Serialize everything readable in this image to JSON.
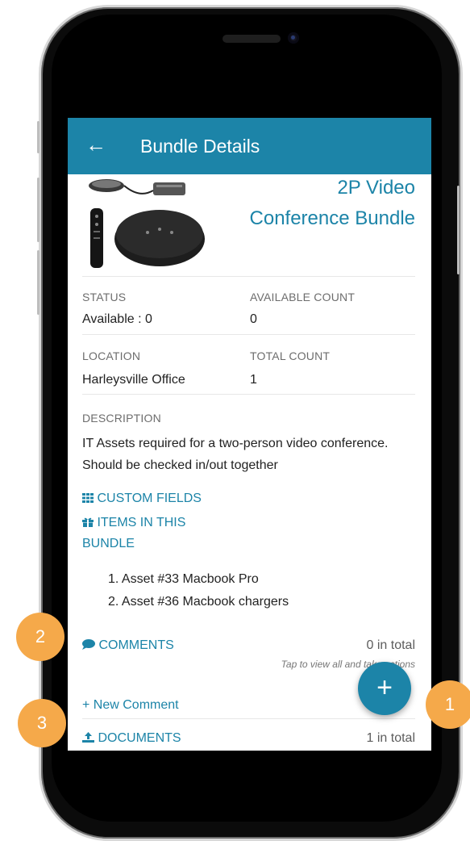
{
  "app": {
    "title": "Bundle Details",
    "back_icon": "arrow-left-icon"
  },
  "bundle": {
    "name_line1": "2P Video",
    "name_line2": "Conference Bundle",
    "status_label": "STATUS",
    "status_value": "Available : 0",
    "available_label": "AVAILABLE COUNT",
    "available_value": "0",
    "location_label": "LOCATION",
    "location_value": "Harleysville Office",
    "total_label": "TOTAL COUNT",
    "total_value": "1",
    "description_label": "DESCRIPTION",
    "description_value": "IT Assets required for a two-person video conference. Should be checked in/out together"
  },
  "links": {
    "custom_fields": "CUSTOM FIELDS",
    "items_in_bundle_line1": "ITEMS IN THIS",
    "items_in_bundle_line2": "BUNDLE"
  },
  "items": [
    "1. Asset #33 Macbook Pro",
    "2. Asset #36 Macbook chargers"
  ],
  "comments": {
    "label": "COMMENTS",
    "total": "0 in total",
    "hint": "Tap to view all and take actions",
    "new_comment": "+ New Comment"
  },
  "documents": {
    "label": "DOCUMENTS",
    "total": "1 in total"
  },
  "fab": {
    "label": "+",
    "icon": "plus-icon"
  },
  "badges": [
    "1",
    "2",
    "3"
  ],
  "colors": {
    "primary": "#1c84a8",
    "badge": "#f5a94a"
  }
}
